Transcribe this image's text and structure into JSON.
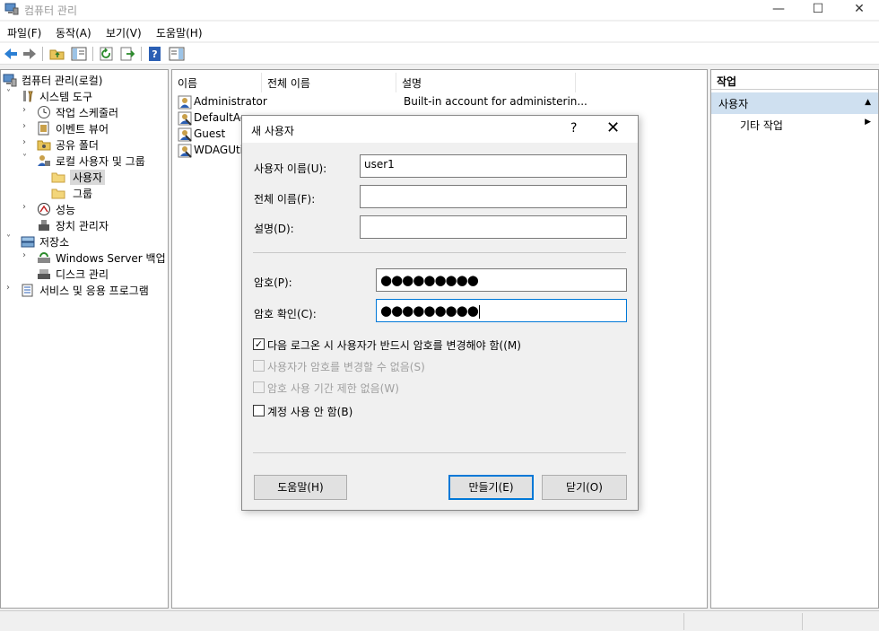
{
  "window": {
    "title": "컴퓨터 관리",
    "minimize": "—",
    "maximize": "☐",
    "close": "✕"
  },
  "menu": [
    "파일(F)",
    "동작(A)",
    "보기(V)",
    "도움말(H)"
  ],
  "tree": [
    {
      "label": "컴퓨터 관리(로컬)",
      "expander": "",
      "icon": "computer-icon"
    },
    {
      "label": "시스템 도구",
      "expander": "˅",
      "icon": "tools-icon"
    },
    {
      "label": "작업 스케줄러",
      "expander": "›",
      "icon": "clock-icon"
    },
    {
      "label": "이벤트 뷰어",
      "expander": "›",
      "icon": "event-viewer-icon"
    },
    {
      "label": "공유 폴더",
      "expander": "›",
      "icon": "shared-folder-icon"
    },
    {
      "label": "로컬 사용자 및 그룹",
      "expander": "˅",
      "icon": "users-group-icon"
    },
    {
      "label": "사용자",
      "expander": "",
      "icon": "folder-icon"
    },
    {
      "label": "그룹",
      "expander": "",
      "icon": "folder-icon"
    },
    {
      "label": "성능",
      "expander": "›",
      "icon": "performance-icon"
    },
    {
      "label": "장치 관리자",
      "expander": "",
      "icon": "device-manager-icon"
    },
    {
      "label": "저장소",
      "expander": "˅",
      "icon": "storage-icon"
    },
    {
      "label": "Windows Server 백업",
      "expander": "›",
      "icon": "backup-icon"
    },
    {
      "label": "디스크 관리",
      "expander": "",
      "icon": "disk-icon"
    },
    {
      "label": "서비스 및 응용 프로그램",
      "expander": "›",
      "icon": "services-icon"
    }
  ],
  "list": {
    "columns": [
      "이름",
      "전체 이름",
      "설명"
    ],
    "rows": [
      {
        "name": "Administrator",
        "description": "Built-in account for administerin..."
      },
      {
        "name": "DefaultAc",
        "description": ""
      },
      {
        "name": "Guest",
        "description": ""
      },
      {
        "name": "WDAGUtil",
        "description": ""
      }
    ]
  },
  "actions": {
    "header": "작업",
    "section": "사용자",
    "section_arrow": "▲",
    "item": "기타 작업",
    "item_arrow": "▶"
  },
  "dialog": {
    "title": "새 사용자",
    "help": "?",
    "close": "✕",
    "username_label": "사용자 이름(U):",
    "username_value": "user1",
    "fullname_label": "전체 이름(F):",
    "fullname_value": "",
    "description_label": "설명(D):",
    "description_value": "",
    "password_label": "암호(P):",
    "password_value": "●●●●●●●●●",
    "confirm_label": "암호 확인(C):",
    "confirm_value": "●●●●●●●●●",
    "checkboxes": [
      {
        "label": "다음 로그온 시 사용자가 반드시 암호를 변경해야 함((M)",
        "checked": true,
        "disabled": false,
        "mark": "✓"
      },
      {
        "label": "사용자가 암호를 변경할 수 없음(S)",
        "checked": false,
        "disabled": true,
        "mark": ""
      },
      {
        "label": "암호 사용 기간 제한 없음(W)",
        "checked": false,
        "disabled": true,
        "mark": ""
      },
      {
        "label": "계정 사용 안 함(B)",
        "checked": false,
        "disabled": false,
        "mark": ""
      }
    ],
    "help_button": "도움말(H)",
    "create_button": "만들기(E)",
    "close_button": "닫기(O)"
  }
}
